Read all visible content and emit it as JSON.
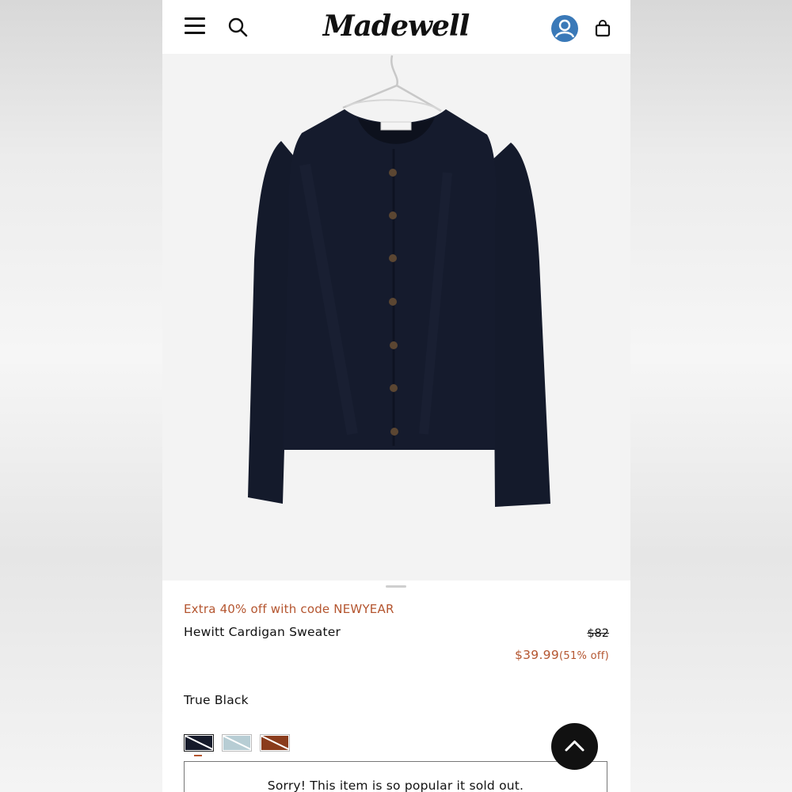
{
  "header": {
    "logo_text": "Madewell",
    "menu_icon": "hamburger-menu-icon",
    "search_icon": "search-icon",
    "account_icon": "account-avatar-icon",
    "bag_icon": "shopping-bag-icon",
    "account_color": "#3a79b8"
  },
  "product": {
    "promo": "Extra 40% off with code NEWYEAR",
    "name": "Hewitt Cardigan Sweater",
    "original_price": "$82",
    "sale_price": "$39.99",
    "discount": "(51% off)",
    "color_name": "True Black",
    "swatches": [
      {
        "name": "True Black",
        "color": "#151a2a",
        "selected": true
      },
      {
        "name": "Light Blue",
        "color": "#b7cdd4",
        "selected": false
      },
      {
        "name": "Rust",
        "color": "#8a3c1c",
        "selected": false
      }
    ],
    "sold_out_message": "Sorry! This item is so popular it sold out."
  },
  "colors": {
    "accent": "#b4552f",
    "text": "#111111"
  },
  "scroll_top_icon": "chevron-up-icon"
}
